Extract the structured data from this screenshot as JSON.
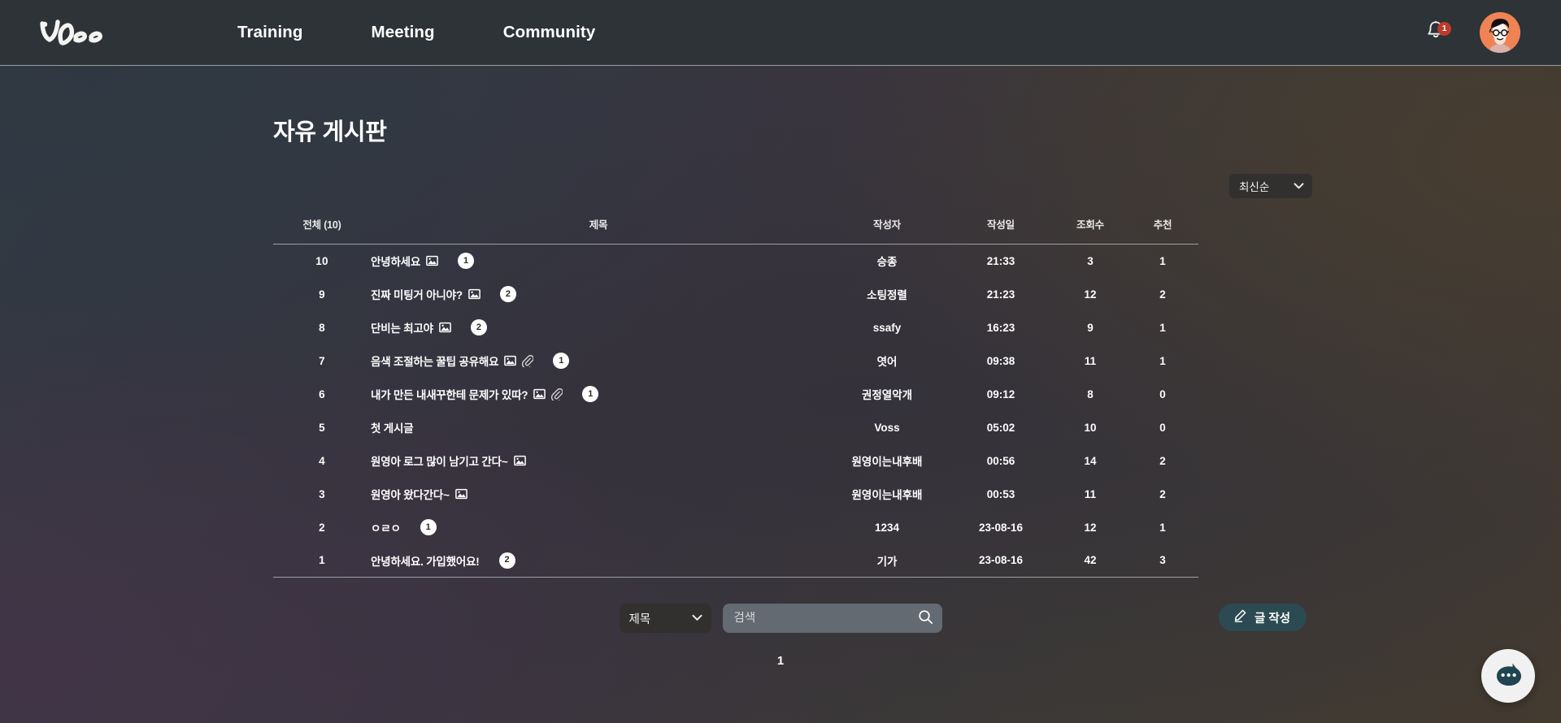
{
  "header": {
    "logo_text": "Voss",
    "logo_icon": "voss-script-logo",
    "nav": [
      {
        "label": "Training"
      },
      {
        "label": "Meeting"
      },
      {
        "label": "Community"
      }
    ],
    "notification": {
      "icon": "bell-icon",
      "badge_count": "1",
      "badge_color": "#c0392b"
    },
    "avatar": {
      "icon": "user-avatar",
      "background_color": "#ef8354"
    }
  },
  "page": {
    "title": "자유 게시판"
  },
  "sort": {
    "selected": "최신순",
    "icon": "chevron-down-icon"
  },
  "table": {
    "columns": [
      {
        "key": "no",
        "label": "전체 (10)"
      },
      {
        "key": "title",
        "label": "제목"
      },
      {
        "key": "user",
        "label": "작성자"
      },
      {
        "key": "date",
        "label": "작성일"
      },
      {
        "key": "views",
        "label": "조회수"
      },
      {
        "key": "likes",
        "label": "추천"
      }
    ],
    "rows": [
      {
        "no": "10",
        "title": "안녕하세요",
        "image": true,
        "file": false,
        "comments": "1",
        "user": "승종",
        "date": "21:33",
        "views": "3",
        "likes": "1"
      },
      {
        "no": "9",
        "title": "진짜 미팅거 아니야?",
        "image": true,
        "file": false,
        "comments": "2",
        "user": "소팅정렬",
        "date": "21:23",
        "views": "12",
        "likes": "2"
      },
      {
        "no": "8",
        "title": "단비는 최고야",
        "image": true,
        "file": false,
        "comments": "2",
        "user": "ssafy",
        "date": "16:23",
        "views": "9",
        "likes": "1"
      },
      {
        "no": "7",
        "title": "음색 조절하는 꿀팁 공유해요",
        "image": true,
        "file": true,
        "comments": "1",
        "user": "엿어",
        "date": "09:38",
        "views": "11",
        "likes": "1"
      },
      {
        "no": "6",
        "title": "내가 만든 내새꾸한테 문제가 있따?",
        "image": true,
        "file": true,
        "comments": "1",
        "user": "권정열악개",
        "date": "09:12",
        "views": "8",
        "likes": "0"
      },
      {
        "no": "5",
        "title": "첫 게시글",
        "image": false,
        "file": false,
        "comments": "",
        "user": "Voss",
        "date": "05:02",
        "views": "10",
        "likes": "0"
      },
      {
        "no": "4",
        "title": "원영아 로그 많이 남기고 간다~",
        "image": true,
        "file": false,
        "comments": "",
        "user": "원영이는내후배",
        "date": "00:56",
        "views": "14",
        "likes": "2"
      },
      {
        "no": "3",
        "title": "원영아 왔다간다~",
        "image": true,
        "file": false,
        "comments": "",
        "user": "원영이는내후배",
        "date": "00:53",
        "views": "11",
        "likes": "2"
      },
      {
        "no": "2",
        "title": "ㅇㄹㅇ",
        "image": false,
        "file": false,
        "comments": "1",
        "user": "1234",
        "date": "23-08-16",
        "views": "12",
        "likes": "1"
      },
      {
        "no": "1",
        "title": "안녕하세요. 가입했어요!",
        "image": false,
        "file": false,
        "comments": "2",
        "user": "기가",
        "date": "23-08-16",
        "views": "42",
        "likes": "3"
      }
    ]
  },
  "search": {
    "filter_selected": "제목",
    "filter_icon": "chevron-down-icon",
    "placeholder": "검색",
    "value": "",
    "search_icon": "search-icon"
  },
  "write_button": {
    "label": "글 작성",
    "icon": "pencil-icon",
    "color": "#2b4a52"
  },
  "pagination": {
    "pages": [
      "1"
    ],
    "current": "1"
  },
  "chat_fab": {
    "icon": "chat-bubble-icon",
    "color": "#1f4650"
  }
}
